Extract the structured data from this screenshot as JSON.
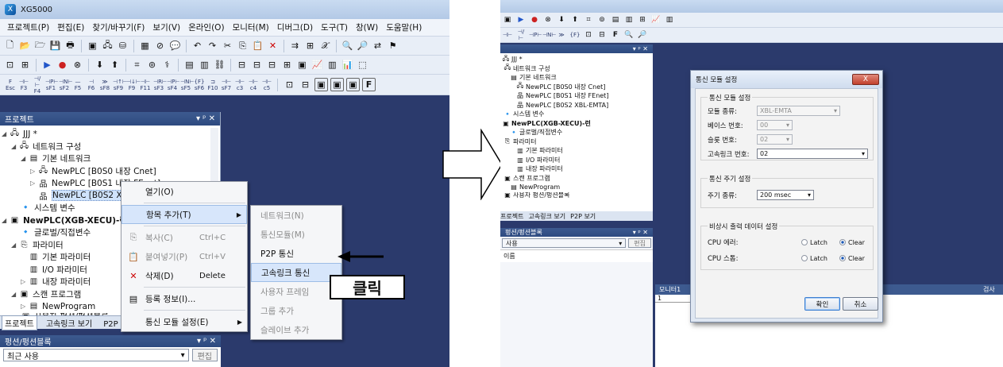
{
  "left": {
    "title": "XG5000",
    "menu": [
      "프로젝트(P)",
      "편집(E)",
      "찾기/바꾸기(F)",
      "보기(V)",
      "온라인(O)",
      "모니터(M)",
      "디버그(D)",
      "도구(T)",
      "창(W)",
      "도움말(H)"
    ],
    "fkeys_top": [
      "F",
      "⊣⊢",
      "⊣/⊢",
      "⊣P⊢",
      "⊣N⊢",
      "—",
      "⊣",
      "≫",
      "⊣↑⊢",
      "⊣↓⊢",
      "⊣⊢",
      "⊣R⊢",
      "⊣P⊢",
      "⊣N⊢",
      "{F}",
      "⊐",
      "⊣⊢",
      "⊣⊢",
      "⊣⊢",
      "⊣⊢"
    ],
    "fkeys_bottom": [
      "Esc",
      "F3",
      "F4",
      "sF1",
      "sF2",
      "F5",
      "F6",
      "sF8",
      "sF9",
      "F9",
      "F11",
      "sF3",
      "sF4",
      "sF5",
      "sF6",
      "F10",
      "sF7",
      "c3",
      "c4",
      "c5",
      "c6"
    ],
    "project_panel": {
      "title": "프로젝트",
      "tree": [
        {
          "label": "JJJ *",
          "icon": "network-icon",
          "level": 0
        },
        {
          "label": "네트워크 구성",
          "icon": "network-icon",
          "level": 1
        },
        {
          "label": "기본 네트워크",
          "icon": "folder-icon",
          "level": 2
        },
        {
          "label": "NewPLC [B0S0 내장 Cnet]",
          "icon": "cnet-icon",
          "level": 3
        },
        {
          "label": "NewPLC [B0S1 내장 FEnet]",
          "icon": "fenet-icon",
          "level": 3
        },
        {
          "label": "NewPLC [B0S2 XBL-EMTA]",
          "icon": "fenet-icon",
          "level": 3
        },
        {
          "label": "시스템 변수",
          "icon": "variable-icon",
          "level": 1
        },
        {
          "label": "NewPLC(XGB-XECU)-런",
          "icon": "plc-icon",
          "level": 0
        },
        {
          "label": "글로벌/직접변수",
          "icon": "variable-icon",
          "level": 1
        },
        {
          "label": "파라미터",
          "icon": "parameter-icon",
          "level": 1
        },
        {
          "label": "기본 파라미터",
          "icon": "param-item-icon",
          "level": 2
        },
        {
          "label": "I/O 파라미터",
          "icon": "param-item-icon",
          "level": 2
        },
        {
          "label": "내장 파라미터",
          "icon": "param-item-icon",
          "level": 2
        },
        {
          "label": "스캔 프로그램",
          "icon": "program-icon",
          "level": 1
        },
        {
          "label": "NewProgram",
          "icon": "program-item-icon",
          "level": 2
        },
        {
          "label": "사용자 펑션/펑션블록",
          "icon": "function-icon",
          "level": 1
        }
      ]
    },
    "tabs": [
      "프로젝트",
      "고속링크 보기",
      "P2P 보기"
    ],
    "line_panel": {
      "title": "펑션/펑션블록",
      "combo_value": "최근 사용",
      "edit_label": "편집"
    },
    "context_menu": [
      {
        "label": "열기(O)",
        "shortcut": "",
        "icon": "",
        "dim": false,
        "sub": false
      },
      {
        "label": "항목 추가(T)",
        "shortcut": "",
        "icon": "",
        "dim": false,
        "sub": true,
        "hl": true
      },
      {
        "label": "복사(C)",
        "shortcut": "Ctrl+C",
        "icon": "copy-icon",
        "dim": true,
        "sub": false
      },
      {
        "label": "붙여넣기(P)",
        "shortcut": "Ctrl+V",
        "icon": "paste-icon",
        "dim": true,
        "sub": false
      },
      {
        "label": "삭제(D)",
        "shortcut": "Delete",
        "icon": "delete-icon",
        "dim": false,
        "sub": false
      },
      {
        "label": "등록 정보(I)...",
        "shortcut": "",
        "icon": "properties-icon",
        "dim": false,
        "sub": false
      },
      {
        "label": "통신 모듈 설정(E)",
        "shortcut": "",
        "icon": "",
        "dim": false,
        "sub": true
      }
    ],
    "submenu": [
      {
        "label": "네트워크(N)",
        "dim": true
      },
      {
        "label": "통신모듈(M)",
        "dim": true
      },
      {
        "label": "P2P 통신",
        "dim": false
      },
      {
        "label": "고속링크 통신",
        "dim": false,
        "hl": true
      },
      {
        "label": "사용자 프레임",
        "dim": true
      },
      {
        "label": "그룹 추가",
        "dim": true
      },
      {
        "label": "슬레이브 추가",
        "dim": true
      }
    ],
    "click_label": "클릭"
  },
  "right": {
    "tree": [
      {
        "label": "JJJ *"
      },
      {
        "label": "네트워크 구성"
      },
      {
        "label": "기본 네트워크"
      },
      {
        "label": "NewPLC [B0S0 내장 Cnet]"
      },
      {
        "label": "NewPLC [B0S1 내장 FEnet]"
      },
      {
        "label": "NewPLC [B0S2 XBL-EMTA]"
      },
      {
        "label": "시스템 변수"
      },
      {
        "label": "NewPLC(XGB-XECU)-런"
      },
      {
        "label": "글로벌/직접변수"
      },
      {
        "label": "파라미터"
      },
      {
        "label": "기본 파라미터"
      },
      {
        "label": "I/O 파라미터"
      },
      {
        "label": "내장 파라미터"
      },
      {
        "label": "스캔 프로그램"
      },
      {
        "label": "NewProgram"
      },
      {
        "label": "사용자 펑션/펑션블록"
      }
    ],
    "tabs": [
      "프로젝트",
      "고속링크 보기",
      "P2P 보기"
    ],
    "line_title": "펑션/펑션블록",
    "line_combo": "사용",
    "line_edit": "편집",
    "line_item": "이름",
    "monitor_label": "모니터1",
    "monitor_row": "1",
    "check_label": "검사",
    "dialog": {
      "title": "통신 모듈 설정",
      "group1": "통신 모듈 설정",
      "module_type_label": "모듈 종류:",
      "module_type_value": "XBL-EMTA",
      "base_label": "베이스 번호:",
      "base_value": "00",
      "slot_label": "슬롯 번호:",
      "slot_value": "02",
      "hslink_label": "고속링크 번호:",
      "hslink_value": "02",
      "group2": "통신 주기 설정",
      "period_label": "주기 종류:",
      "period_value": "200 msec",
      "group3": "비상시 출력 데이터 설정",
      "cpu_error_label": "CPU 에러:",
      "cpu_stop_label": "CPU 스톱:",
      "latch_label": "Latch",
      "clear_label": "Clear",
      "ok_label": "확인",
      "cancel_label": "취소",
      "close_label": "X"
    }
  }
}
